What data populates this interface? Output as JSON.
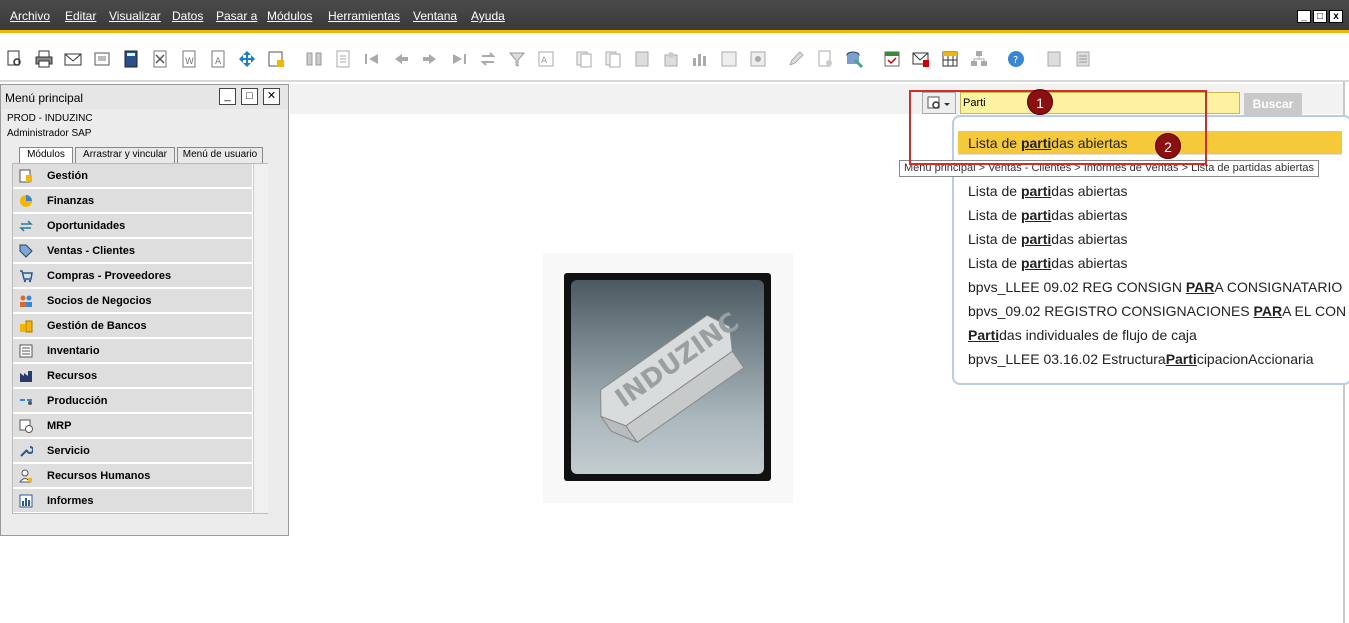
{
  "menubar": {
    "items": [
      "Archivo",
      "Editar",
      "Visualizar",
      "Datos",
      "Pasar a",
      "Módulos",
      "Herramientas",
      "Ventana",
      "Ayuda"
    ],
    "window_buttons": [
      "_",
      "□",
      "x"
    ]
  },
  "main_menu": {
    "title": "Menú principal",
    "company": "PROD - INDUZINC",
    "user": "Administrador SAP",
    "tabs": [
      "Módulos",
      "Arrastrar y vincular",
      "Menú de usuario"
    ],
    "modules": [
      "Gestión",
      "Finanzas",
      "Oportunidades",
      "Ventas - Clientes",
      "Compras - Proveedores",
      "Socios de Negocios",
      "Gestión de Bancos",
      "Inventario",
      "Recursos",
      "Producción",
      "MRP",
      "Servicio",
      "Recursos Humanos",
      "Informes"
    ]
  },
  "search": {
    "value": "Parti",
    "button_label": "Buscar"
  },
  "results": [
    {
      "pre": "Lista de ",
      "match": "parti",
      "post": "das abiertas"
    },
    {
      "pre": "Lista de ",
      "match": "parti",
      "post": "das abiertas"
    },
    {
      "pre": "Lista de ",
      "match": "parti",
      "post": "das abiertas"
    },
    {
      "pre": "Lista de ",
      "match": "parti",
      "post": "das abiertas"
    },
    {
      "pre": "Lista de ",
      "match": "parti",
      "post": "das abiertas"
    },
    {
      "pre": "bpvs_LLEE 09.02 REG CONSIGN ",
      "match": "PAR",
      "post": "A CONSIGNATARIO"
    },
    {
      "pre": "bpvs_09.02 REGISTRO CONSIGNACIONES ",
      "match": "PAR",
      "post": "A EL CON"
    },
    {
      "pre": "",
      "match": "Parti",
      "post": "das individuales de flujo de caja"
    },
    {
      "pre": "bpvs_LLEE 03.16.02 Estructura",
      "match": "Parti",
      "post": "cipacionAccionaria"
    }
  ],
  "tooltip": "Menú principal > Ventas - Clientes > Informes de Ventas > Lista de partidas abiertas",
  "badges": [
    "1",
    "2"
  ],
  "logo_text": "INDUZINC",
  "colors": {
    "accent": "#f2b705",
    "highlight": "#f6c93a",
    "badge": "#8b1010",
    "annotation": "#d42b2b"
  }
}
